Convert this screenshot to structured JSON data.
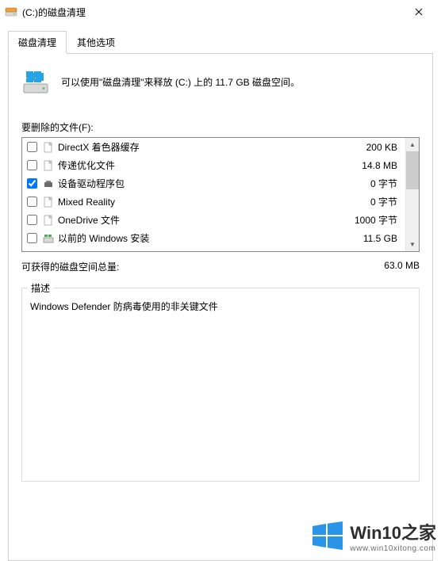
{
  "window": {
    "title": "(C:)的磁盘清理",
    "icon": "drive-icon"
  },
  "tabs": [
    {
      "label": "磁盘清理",
      "active": true
    },
    {
      "label": "其他选项",
      "active": false
    }
  ],
  "intro_text": "可以使用\"磁盘清理\"来释放  (C:) 上的 11.7 GB 磁盘空间。",
  "files_label": "要删除的文件(F):",
  "files": [
    {
      "checked": false,
      "icon": "file-icon",
      "name": "DirectX 着色器缓存",
      "size": "200 KB"
    },
    {
      "checked": false,
      "icon": "file-icon",
      "name": "传递优化文件",
      "size": "14.8 MB"
    },
    {
      "checked": true,
      "icon": "device-icon",
      "name": "设备驱动程序包",
      "size": "0 字节"
    },
    {
      "checked": false,
      "icon": "file-icon",
      "name": "Mixed Reality",
      "size": "0 字节"
    },
    {
      "checked": false,
      "icon": "file-icon",
      "name": "OneDrive 文件",
      "size": "1000 字节"
    },
    {
      "checked": false,
      "icon": "winold-icon",
      "name": "以前的 Windows 安装",
      "size": "11.5 GB"
    }
  ],
  "total": {
    "label": "可获得的磁盘空间总量:",
    "value": "63.0 MB"
  },
  "description": {
    "legend": "描述",
    "text": "Windows Defender 防病毒使用的非关键文件"
  },
  "watermark": {
    "brand": "Win10之家",
    "url": "www.win10xitong.com"
  }
}
